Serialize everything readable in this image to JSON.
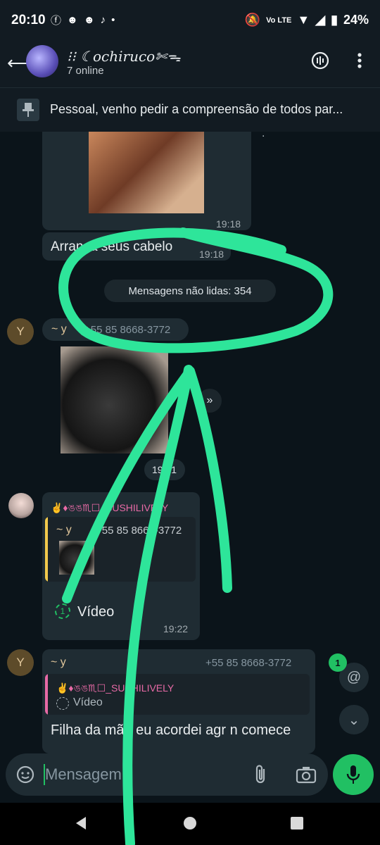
{
  "status": {
    "time": "20:10",
    "battery": "24%",
    "icons": [
      "facebook-icon",
      "mask-icon",
      "mask-icon",
      "tiktok-icon",
      "dot-icon"
    ]
  },
  "header": {
    "group_name": "⁝⁝ ☾ochiruco✄ᯓ",
    "online": "7 online"
  },
  "pinned": {
    "text": "Pessoal, venho pedir a compreensão de todos par..."
  },
  "messages": [
    {
      "time": "19:18"
    },
    {
      "text": "Arranca seus cabelo",
      "time": "19:18"
    },
    {
      "unread_banner": "Mensagens não lidas: 354"
    },
    {
      "sender": "~ y",
      "avatar": "Y",
      "phone": "+55 85 8668-3772",
      "time": "19:21"
    },
    {
      "sender": "✌♦ঙঙ♏︎☐_SUSHILIVELY",
      "reply_sender": "~ y",
      "reply_phone": "+55 85 8668-3772",
      "text": "Vídeo",
      "time": "19:22"
    },
    {
      "sender": "~ y",
      "avatar": "Y",
      "phone": "+55 85 8668-3772",
      "reply_sender": "✌♦ঙঙ♏︎☐_SUSHILIVELY",
      "reply_text": "Vídeo",
      "text": "Filha da mãe eu acordei agr n comece"
    }
  ],
  "input": {
    "placeholder": "Mensagem"
  },
  "fab": {
    "mentions_count": "1"
  },
  "colors": {
    "accent": "#21c063",
    "annotation": "#2ee59a",
    "quote_yellow": "#f2c94c",
    "quote_pink": "#e86aa6"
  }
}
